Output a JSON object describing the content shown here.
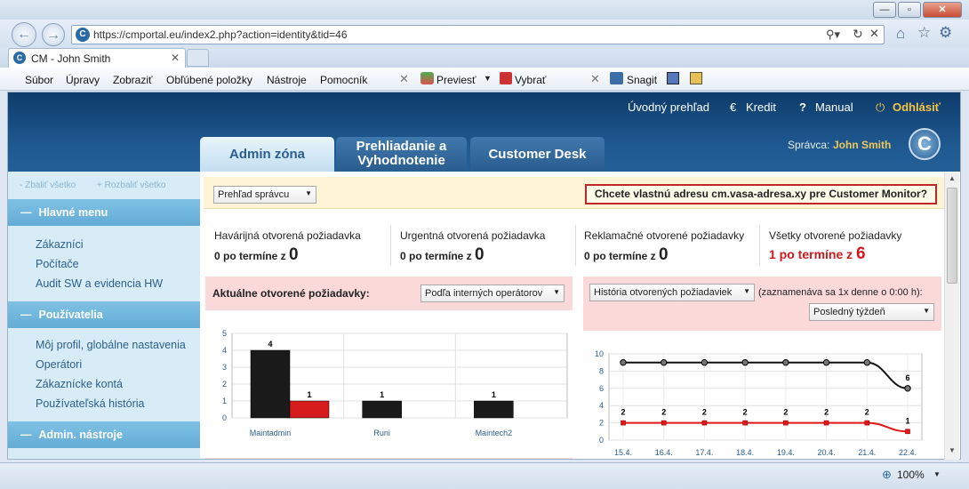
{
  "browser": {
    "url": "https://cmportal.eu/index2.php?action=identity&tid=46",
    "tab_title": "CM - John Smith",
    "zoom": "100%",
    "menu": [
      "Súbor",
      "Úpravy",
      "Zobraziť",
      "Obľúbené položky",
      "Nástroje",
      "Pomocník"
    ],
    "toolbar": {
      "previest": "Previesť",
      "vybrat": "Vybrať",
      "snagit": "Snagit"
    }
  },
  "header": {
    "links": {
      "overview": "Úvodný prehľad",
      "credit": "Kredit",
      "manual": "Manual",
      "logout": "Odhlásiť"
    },
    "tabs": [
      "Admin zóna",
      "Prehliadanie a Vyhodnotenie",
      "Customer Desk"
    ],
    "admin_label": "Správca:",
    "admin_name": "John Smith"
  },
  "sidebar": {
    "collapse_all": "- Zbaliť všetko",
    "expand_all": "+ Rozbaliť všetko",
    "sections": [
      {
        "title": "Hlavné menu",
        "items": [
          "Zákazníci",
          "Počítače",
          "Audit SW a evidencia HW"
        ]
      },
      {
        "title": "Používatelia",
        "items": [
          "Môj profil, globálne nastavenia",
          "Operátori",
          "Zákaznícke kontá",
          "Používateľská história"
        ]
      },
      {
        "title": "Admin. nástroje",
        "items": []
      }
    ]
  },
  "main": {
    "view_select": "Prehľad správcu",
    "promo": "Chcete vlastnú adresu cm.vasa-adresa.xy pre Customer Monitor?",
    "cards": [
      {
        "title": "Havárijná otvorená požiadavka",
        "prefix": "0 po termíne z",
        "value": "0"
      },
      {
        "title": "Urgentná otvorená požiadavka",
        "prefix": "0 po termíne z",
        "value": "0"
      },
      {
        "title": "Reklamačné otvorené požiadavky",
        "prefix": "0 po termíne z",
        "value": "0"
      },
      {
        "title": "Všetky otvorené požiadavky",
        "prefix": "1 po termíne z",
        "value": "6"
      }
    ],
    "left_panel": {
      "title": "Aktuálne otvorené požiadavky:",
      "select": "Podľa interných operátorov"
    },
    "right_panel": {
      "select": "História otvorených požiadaviek",
      "note": "(zaznamenáva sa 1x denne o 0:00 h):",
      "period": "Posledný týždeň"
    }
  },
  "chart_data": [
    {
      "type": "bar",
      "categories": [
        "Maintadmin",
        "Runi",
        "Maintech2"
      ],
      "series": [
        {
          "values": [
            4,
            1,
            1
          ]
        },
        {
          "values": [
            1,
            0,
            0
          ]
        }
      ],
      "ylim": [
        0,
        5
      ],
      "yticks": [
        0,
        1,
        2,
        3,
        4,
        5
      ],
      "colors": [
        "#1a1a1a",
        "#d61c1c"
      ]
    },
    {
      "type": "line",
      "categories": [
        "15.4.",
        "16.4.",
        "17.4.",
        "18.4.",
        "19.4.",
        "20.4.",
        "21.4.",
        "22.4."
      ],
      "series": [
        {
          "values": [
            9,
            9,
            9,
            9,
            9,
            9,
            9,
            6
          ]
        },
        {
          "values": [
            2,
            2,
            2,
            2,
            2,
            2,
            2,
            1
          ]
        }
      ],
      "ylim": [
        0,
        10
      ],
      "yticks": [
        0,
        2,
        4,
        6,
        8,
        10
      ],
      "colors": [
        "#111111",
        "#e01818"
      ]
    }
  ]
}
